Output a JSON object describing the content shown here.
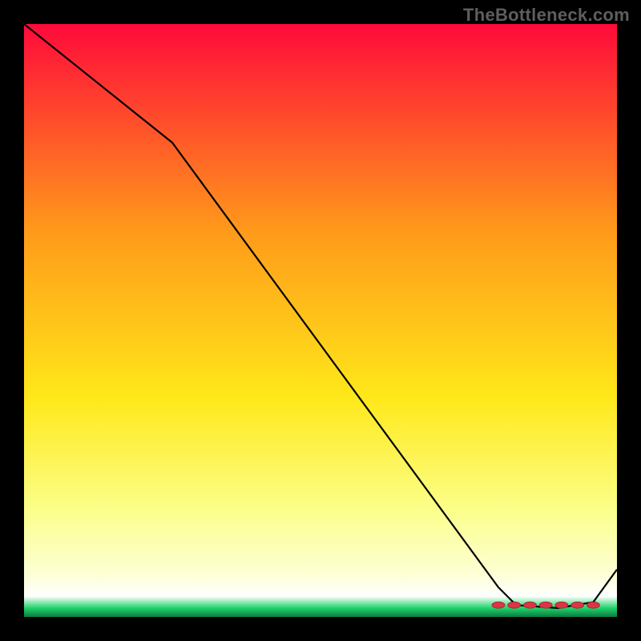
{
  "watermark": {
    "text": "TheBottleneck.com"
  },
  "colors": {
    "bg": "#000000",
    "line": "#000000",
    "marker_fill": "#dc3545",
    "marker_stroke": "#9d242f",
    "grad_top": "#ff0a3a",
    "grad_mid_upper": "#ff9a1a",
    "grad_mid": "#ffe81a",
    "grad_mid_lower": "#fbff8a",
    "grad_pale": "#fdffd6",
    "grad_green": "#20d36a"
  },
  "chart_data": {
    "type": "line",
    "title": "",
    "xlabel": "",
    "ylabel": "",
    "xlim": [
      0,
      100
    ],
    "ylim": [
      0,
      100
    ],
    "grid": false,
    "series": [
      {
        "name": "curve",
        "x": [
          0,
          25,
          80,
          83,
          90,
          96,
          100
        ],
        "values": [
          100,
          80,
          5,
          2,
          1.5,
          2.5,
          8
        ]
      }
    ],
    "flat_segment": {
      "x_start": 80,
      "x_end": 96,
      "y": 2,
      "marker_count": 7
    },
    "annotations": []
  }
}
